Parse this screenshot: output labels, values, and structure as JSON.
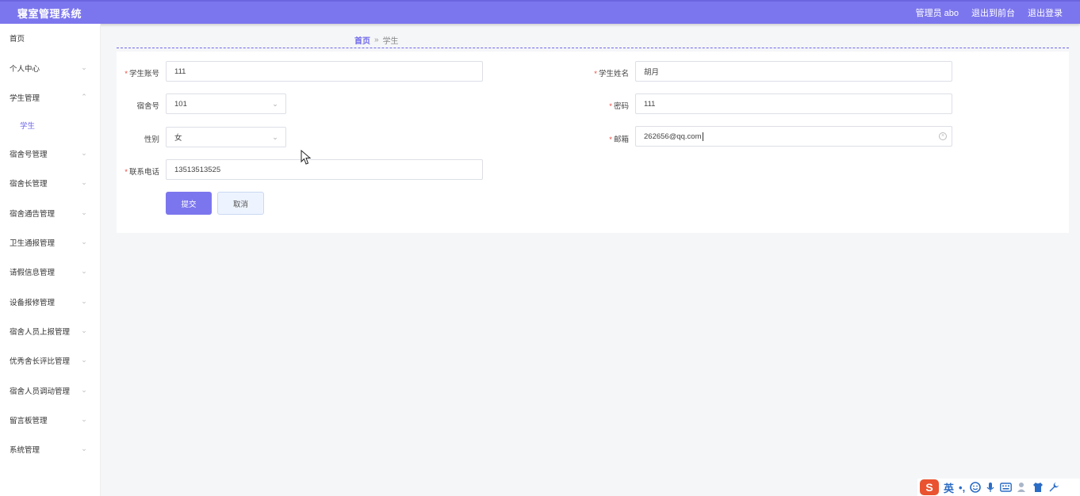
{
  "header": {
    "title": "寝室管理系统",
    "admin_label": "管理员 abo",
    "back_front": "退出到前台",
    "logout": "退出登录"
  },
  "sidebar": {
    "items": [
      {
        "label": "首页"
      },
      {
        "label": "个人中心"
      },
      {
        "label": "学生管理"
      },
      {
        "label": "学生"
      },
      {
        "label": "宿舍号管理"
      },
      {
        "label": "宿舍长管理"
      },
      {
        "label": "宿舍通告管理"
      },
      {
        "label": "卫生通报管理"
      },
      {
        "label": "请假信息管理"
      },
      {
        "label": "设备报修管理"
      },
      {
        "label": "宿舍人员上报管理"
      },
      {
        "label": "优秀舍长评比管理"
      },
      {
        "label": "宿舍人员调动管理"
      },
      {
        "label": "留言板管理"
      },
      {
        "label": "系统管理"
      }
    ]
  },
  "breadcrumb": {
    "home": "首页",
    "separator": "»",
    "current": "学生"
  },
  "form": {
    "required_mark": "*",
    "student_account": {
      "label": "学生账号",
      "value": "111"
    },
    "student_name": {
      "label": "学生姓名",
      "value": "胡月"
    },
    "dorm_no": {
      "label": "宿舍号",
      "value": "101"
    },
    "password": {
      "label": "密码",
      "value": "111"
    },
    "gender": {
      "label": "性别",
      "value": "女"
    },
    "email": {
      "label": "邮箱",
      "value": "262656@qq.com"
    },
    "phone": {
      "label": "联系电话",
      "value": "13513513525"
    },
    "submit_label": "提交",
    "cancel_label": "取消"
  },
  "ime": {
    "logo": "S",
    "lang": "英",
    "punct": "•,"
  },
  "colors": {
    "accent": "#7c76ee",
    "required": "#e9483f"
  }
}
